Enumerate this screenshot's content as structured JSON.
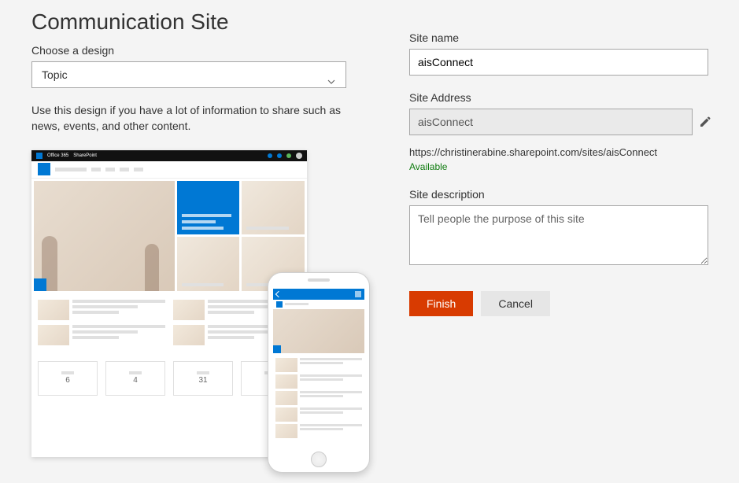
{
  "header": {
    "title": "Communication Site"
  },
  "design": {
    "label": "Choose a design",
    "selected": "Topic",
    "description": "Use this design if you have a lot of information to share such as news, events, and other content."
  },
  "preview": {
    "calendar_days": [
      "6",
      "4",
      "31"
    ]
  },
  "form": {
    "site_name": {
      "label": "Site name",
      "value": "aisConnect"
    },
    "site_address": {
      "label": "Site Address",
      "value": "aisConnect",
      "url": "https://christinerabine.sharepoint.com/sites/aisConnect",
      "status": "Available"
    },
    "site_description": {
      "label": "Site description",
      "placeholder": "Tell people the purpose of this site"
    }
  },
  "buttons": {
    "finish": "Finish",
    "cancel": "Cancel"
  }
}
